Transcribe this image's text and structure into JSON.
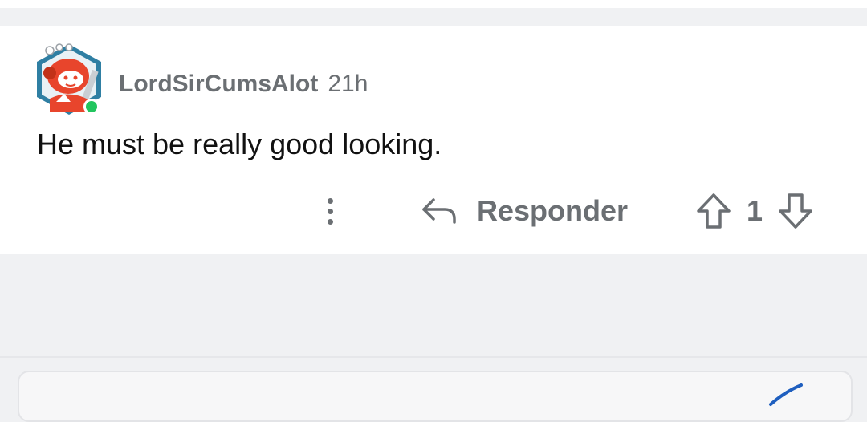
{
  "comment": {
    "username": "LordSirCumsAlot",
    "age": "21h",
    "body": "He must be really good looking.",
    "online": true
  },
  "actions": {
    "more_icon": "more-vertical-icon",
    "reply_icon": "reply-arrow-icon",
    "reply_label": "Responder",
    "upvote_icon": "upvote-arrow-icon",
    "score": "1",
    "downvote_icon": "downvote-arrow-icon"
  },
  "colors": {
    "page_background": "#f0f1f3",
    "card_background": "#ffffff",
    "muted_text": "#6b6f73",
    "body_text": "#111111",
    "online_indicator": "#22c55e",
    "avatar_primary": "#e8452c",
    "avatar_frame": "#2f7fa3"
  }
}
